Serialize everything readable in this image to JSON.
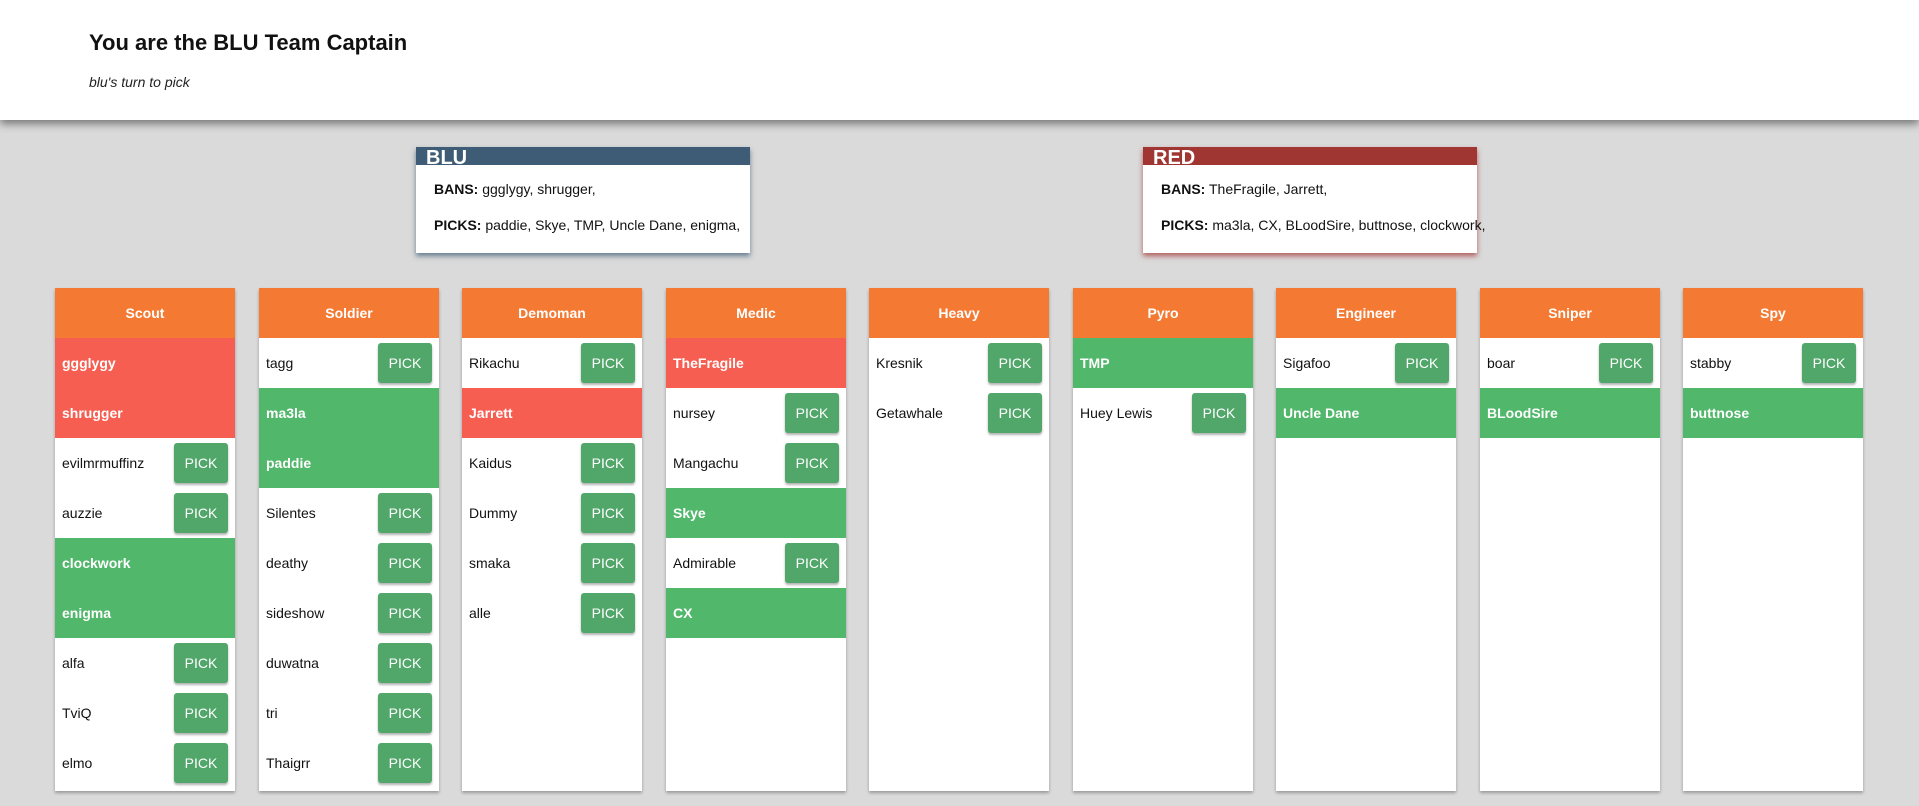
{
  "header": {
    "title": "You are the BLU Team Captain",
    "subtitle": "blu's turn to pick"
  },
  "teams": {
    "blu": {
      "name": "BLU",
      "color": "#3e5c76",
      "bans_label": "BANS:",
      "bans": "ggglygy, shrugger,",
      "picks_label": "PICKS:",
      "picks": "paddie, Skye, TMP, Uncle Dane, enigma,"
    },
    "red": {
      "name": "RED",
      "color": "#a03632",
      "bans_label": "BANS:",
      "bans": "TheFragile, Jarrett,",
      "picks_label": "PICKS:",
      "picks": "ma3la, CX, BLoodSire, buttnose, clockwork,"
    }
  },
  "colors": {
    "class_header": "#f47a33",
    "banned": "#f75e52",
    "picked": "#51b76b",
    "pick_button": "#51a66a",
    "background": "#dadada"
  },
  "pick_label": "PICK",
  "classes": [
    {
      "name": "Scout",
      "players": [
        {
          "name": "ggglygy",
          "status": "banned"
        },
        {
          "name": "shrugger",
          "status": "banned"
        },
        {
          "name": "evilmrmuffinz",
          "status": "available"
        },
        {
          "name": "auzzie",
          "status": "available"
        },
        {
          "name": "clockwork",
          "status": "picked"
        },
        {
          "name": "enigma",
          "status": "picked"
        },
        {
          "name": "alfa",
          "status": "available"
        },
        {
          "name": "TviQ",
          "status": "available"
        },
        {
          "name": "elmo",
          "status": "available"
        }
      ]
    },
    {
      "name": "Soldier",
      "players": [
        {
          "name": "tagg",
          "status": "available"
        },
        {
          "name": "ma3la",
          "status": "picked"
        },
        {
          "name": "paddie",
          "status": "picked"
        },
        {
          "name": "Silentes",
          "status": "available"
        },
        {
          "name": "deathy",
          "status": "available"
        },
        {
          "name": "sideshow",
          "status": "available"
        },
        {
          "name": "duwatna",
          "status": "available"
        },
        {
          "name": "tri",
          "status": "available"
        },
        {
          "name": "Thaigrr",
          "status": "available"
        }
      ]
    },
    {
      "name": "Demoman",
      "players": [
        {
          "name": "Rikachu",
          "status": "available"
        },
        {
          "name": "Jarrett",
          "status": "banned"
        },
        {
          "name": "Kaidus",
          "status": "available"
        },
        {
          "name": "Dummy",
          "status": "available"
        },
        {
          "name": "smaka",
          "status": "available"
        },
        {
          "name": "alle",
          "status": "available"
        }
      ]
    },
    {
      "name": "Medic",
      "players": [
        {
          "name": "TheFragile",
          "status": "banned"
        },
        {
          "name": "nursey",
          "status": "available"
        },
        {
          "name": "Mangachu",
          "status": "available"
        },
        {
          "name": "Skye",
          "status": "picked"
        },
        {
          "name": "Admirable",
          "status": "available"
        },
        {
          "name": "CX",
          "status": "picked"
        }
      ]
    },
    {
      "name": "Heavy",
      "players": [
        {
          "name": "Kresnik",
          "status": "available"
        },
        {
          "name": "Getawhale",
          "status": "available"
        }
      ]
    },
    {
      "name": "Pyro",
      "players": [
        {
          "name": "TMP",
          "status": "picked"
        },
        {
          "name": "Huey Lewis",
          "status": "available"
        }
      ]
    },
    {
      "name": "Engineer",
      "players": [
        {
          "name": "Sigafoo",
          "status": "available"
        },
        {
          "name": "Uncle Dane",
          "status": "picked"
        }
      ]
    },
    {
      "name": "Sniper",
      "players": [
        {
          "name": "boar",
          "status": "available"
        },
        {
          "name": "BLoodSire",
          "status": "picked"
        }
      ]
    },
    {
      "name": "Spy",
      "players": [
        {
          "name": "stabby",
          "status": "available"
        },
        {
          "name": "buttnose",
          "status": "picked"
        }
      ]
    }
  ]
}
